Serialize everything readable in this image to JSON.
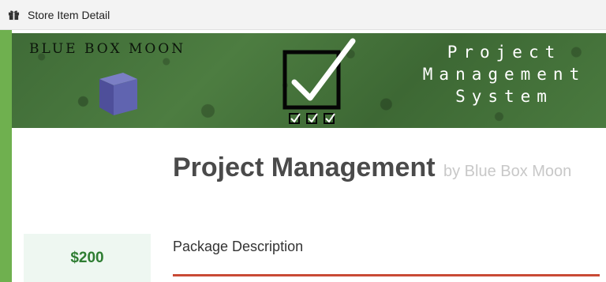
{
  "window": {
    "title": "Store Item Detail",
    "icon": "gift-icon"
  },
  "banner": {
    "brand": "BLUE BOX MOON",
    "tagline": [
      "Project",
      "Management",
      "System"
    ]
  },
  "item": {
    "name": "Project Management",
    "by": "by Blue Box Moon",
    "price": "$200",
    "section_title": "Package Description"
  },
  "colors": {
    "frame": "#6fb04f",
    "price": "#2e7d32",
    "price_bg": "#eef7f1",
    "accent_rule": "#c94a35"
  }
}
